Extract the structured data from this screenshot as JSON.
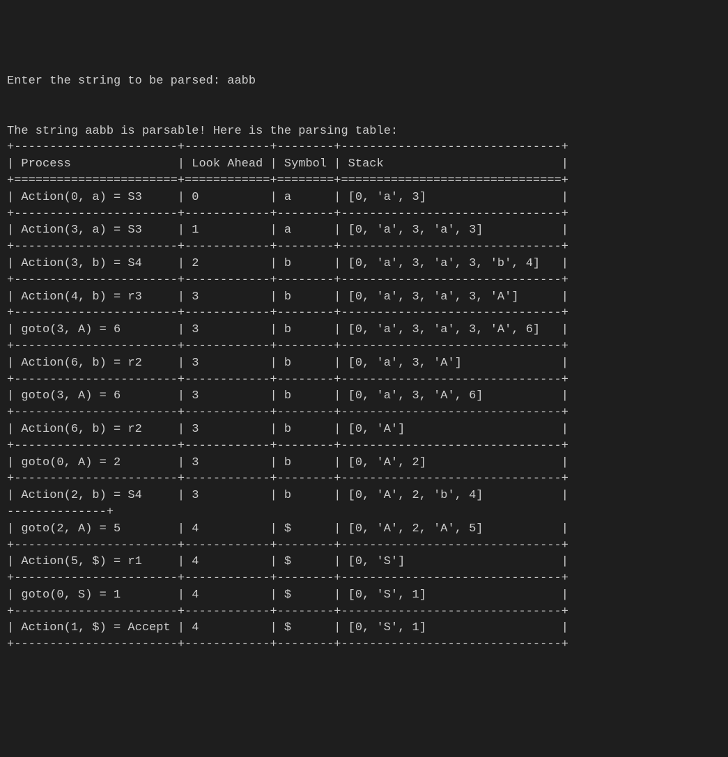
{
  "prompt_text": "Enter the string to be parsed: ",
  "input_value": "aabb",
  "result_prefix": "The string ",
  "result_string": "aabb",
  "result_mid": " is",
  "result_suffix": "parsable! Here is the parsing table:",
  "chart_data": {
    "type": "table",
    "headers": [
      "Process",
      "Look Ahead",
      "Symbol",
      "Stack"
    ],
    "rows": [
      {
        "process": "Action(0, a) = S3",
        "look_ahead": "0",
        "symbol": "a",
        "stack": "[0, 'a', 3]"
      },
      {
        "process": "Action(3, a) = S3",
        "look_ahead": "1",
        "symbol": "a",
        "stack": "[0, 'a', 3, 'a', 3]"
      },
      {
        "process": "Action(3, b) = S4",
        "look_ahead": "2",
        "symbol": "b",
        "stack": "[0, 'a', 3, 'a', 3, 'b', 4]"
      },
      {
        "process": "Action(4, b) = r3",
        "look_ahead": "3",
        "symbol": "b",
        "stack": "[0, 'a', 3, 'a', 3, 'A']"
      },
      {
        "process": "goto(3, A) = 6",
        "look_ahead": "3",
        "symbol": "b",
        "stack": "[0, 'a', 3, 'a', 3, 'A', 6]"
      },
      {
        "process": "Action(6, b) = r2",
        "look_ahead": "3",
        "symbol": "b",
        "stack": "[0, 'a', 3, 'A']"
      },
      {
        "process": "goto(3, A) = 6",
        "look_ahead": "3",
        "symbol": "b",
        "stack": "[0, 'a', 3, 'A', 6]"
      },
      {
        "process": "Action(6, b) = r2",
        "look_ahead": "3",
        "symbol": "b",
        "stack": "[0, 'A']"
      },
      {
        "process": "goto(0, A) = 2",
        "look_ahead": "3",
        "symbol": "b",
        "stack": "[0, 'A', 2]"
      },
      {
        "process": "Action(2, b) = S4",
        "look_ahead": "3",
        "symbol": "b",
        "stack": "[0, 'A', 2, 'b', 4]"
      },
      {
        "process": "goto(2, A) = 5",
        "look_ahead": "4",
        "symbol": "$",
        "stack": "[0, 'A', 2, 'A', 5]"
      },
      {
        "process": "Action(5, $) = r1",
        "look_ahead": "4",
        "symbol": "$",
        "stack": "[0, 'S']"
      },
      {
        "process": "goto(0, S) = 1",
        "look_ahead": "4",
        "symbol": "$",
        "stack": "[0, 'S', 1]"
      },
      {
        "process": "Action(1, $) = Accept",
        "look_ahead": "4",
        "symbol": "$",
        "stack": "[0, 'S', 1]"
      }
    ]
  },
  "col_widths": {
    "process": 23,
    "look_ahead": 12,
    "symbol": 8,
    "stack": 31
  }
}
